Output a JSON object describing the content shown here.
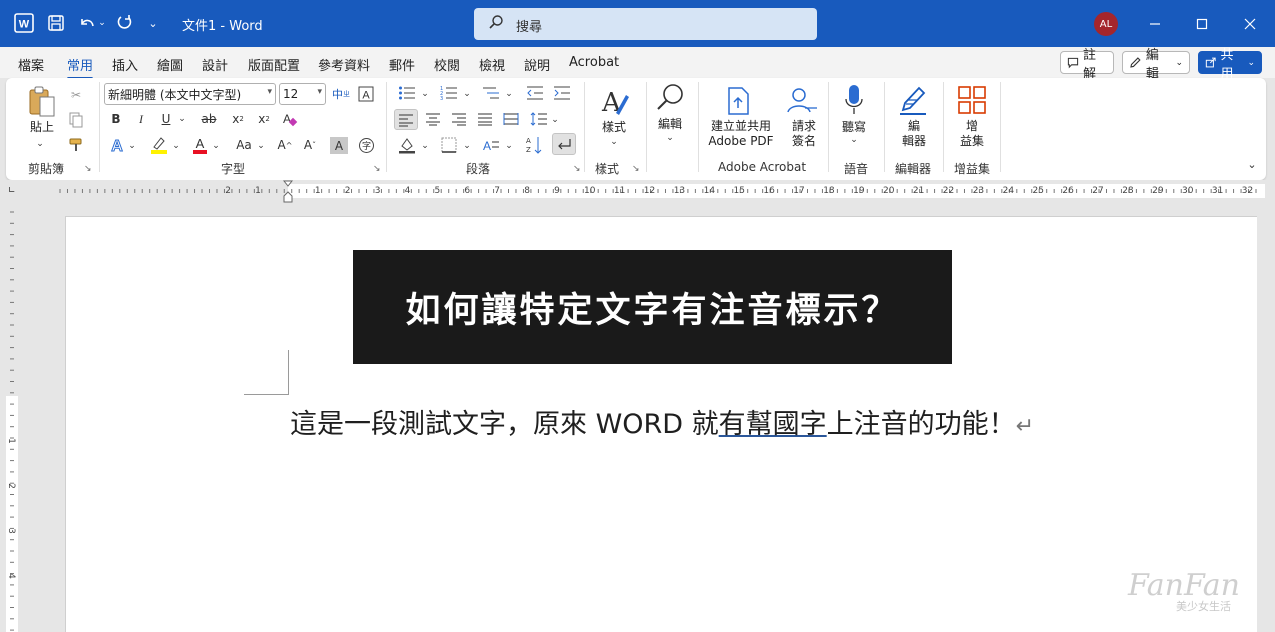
{
  "titlebar": {
    "doc_title": "文件1 - Word",
    "search_placeholder": "搜尋",
    "avatar_initials": "AL",
    "icons": [
      "word-app-icon",
      "save-icon",
      "undo-icon",
      "redo-icon",
      "customize-qat-icon"
    ]
  },
  "tabs": [
    {
      "label": "檔案",
      "active": false
    },
    {
      "label": "常用",
      "active": true
    },
    {
      "label": "插入",
      "active": false
    },
    {
      "label": "繪圖",
      "active": false
    },
    {
      "label": "設計",
      "active": false
    },
    {
      "label": "版面配置",
      "active": false
    },
    {
      "label": "參考資料",
      "active": false
    },
    {
      "label": "郵件",
      "active": false
    },
    {
      "label": "校閱",
      "active": false
    },
    {
      "label": "檢視",
      "active": false
    },
    {
      "label": "說明",
      "active": false
    },
    {
      "label": "Acrobat",
      "active": false
    }
  ],
  "header_buttons": {
    "comments": "註解",
    "editing": "編輯",
    "share": "共用"
  },
  "ribbon": {
    "clipboard": {
      "paste": "貼上",
      "group": "剪貼簿"
    },
    "font": {
      "font_name": "新細明體 (本文中文字型)",
      "font_size": "12",
      "group": "字型",
      "case_label": "Aa"
    },
    "paragraph": {
      "group": "段落"
    },
    "styles": {
      "label": "樣式",
      "group": "樣式"
    },
    "editing": {
      "label": "編輯"
    },
    "acrobat": {
      "create_line1": "建立並共用",
      "create_line2": "Adobe PDF",
      "sign_line1": "請求",
      "sign_line2": "簽名",
      "group": "Adobe Acrobat"
    },
    "voice": {
      "label": "聽寫",
      "group": "語音"
    },
    "editor": {
      "line1": "編",
      "line2": "輯器",
      "group": "編輯器"
    },
    "addins": {
      "line1": "增",
      "line2": "益集",
      "group": "增益集"
    }
  },
  "ruler": {
    "marks": [
      "2",
      "1",
      "1",
      "2",
      "3",
      "4",
      "5",
      "6",
      "7",
      "8",
      "9",
      "10",
      "11",
      "12",
      "13",
      "14",
      "15",
      "16",
      "17",
      "18",
      "19",
      "20",
      "21",
      "22",
      "23",
      "24",
      "25",
      "26",
      "27",
      "28",
      "29",
      "30",
      "31",
      "32"
    ],
    "vertical_marks": [
      "1",
      "2",
      "3",
      "4"
    ]
  },
  "document": {
    "banner_title": "如何讓特定文字有注音標示？",
    "text_before": "這是一段測試文字，原來 WORD 就",
    "text_underlined": "有幫國字",
    "text_after": "上注音的功能！",
    "paragraph_mark": "↵"
  },
  "watermark": {
    "main": "FanFan",
    "sub": "美少女生活"
  },
  "colors": {
    "accent": "#185abd",
    "avatar": "#a4262c",
    "banner": "#1a1a1a"
  }
}
